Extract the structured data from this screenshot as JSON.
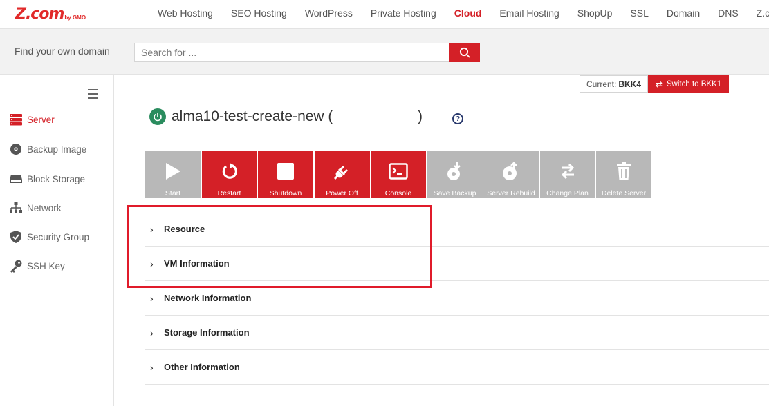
{
  "brand": {
    "logo_text": "Z.com",
    "logo_sub": "by GMO"
  },
  "nav": {
    "links": [
      {
        "label": "Web Hosting"
      },
      {
        "label": "SEO Hosting"
      },
      {
        "label": "WordPress"
      },
      {
        "label": "Private Hosting"
      },
      {
        "label": "Cloud",
        "active": true
      },
      {
        "label": "Email Hosting"
      },
      {
        "label": "ShopUp"
      },
      {
        "label": "SSL"
      },
      {
        "label": "Domain"
      },
      {
        "label": "DNS"
      },
      {
        "label": "Z.com S"
      }
    ]
  },
  "search": {
    "label": "Find your own domain",
    "placeholder": "Search for ..."
  },
  "sidebar": {
    "items": [
      {
        "label": "Server",
        "icon": "server-icon",
        "active": true
      },
      {
        "label": "Backup Image",
        "icon": "backup-image-icon"
      },
      {
        "label": "Block Storage",
        "icon": "block-storage-icon"
      },
      {
        "label": "Network",
        "icon": "network-icon"
      },
      {
        "label": "Security Group",
        "icon": "shield-icon"
      },
      {
        "label": "SSH Key",
        "icon": "key-icon"
      }
    ]
  },
  "region": {
    "current_label": "Current:",
    "current_value": "BKK4",
    "switch_label": "Switch to BKK1"
  },
  "server": {
    "name": "alma10-test-create-new (                     )",
    "help": "?"
  },
  "actions": [
    {
      "label": "Start",
      "enabled": false,
      "icon": "play-icon"
    },
    {
      "label": "Restart",
      "enabled": true,
      "icon": "restart-icon"
    },
    {
      "label": "Shutdown",
      "enabled": true,
      "icon": "stop-icon"
    },
    {
      "label": "Power Off",
      "enabled": true,
      "icon": "plug-icon"
    },
    {
      "label": "Console",
      "enabled": true,
      "icon": "console-icon"
    },
    {
      "label": "Save Backup",
      "enabled": false,
      "icon": "save-backup-icon"
    },
    {
      "label": "Server Rebuild",
      "enabled": false,
      "icon": "rebuild-icon"
    },
    {
      "label": "Change Plan",
      "enabled": false,
      "icon": "change-plan-icon"
    },
    {
      "label": "Delete Server",
      "enabled": false,
      "icon": "trash-icon"
    }
  ],
  "sections": [
    {
      "label": "Resource"
    },
    {
      "label": "VM Information"
    },
    {
      "label": "Network Information"
    },
    {
      "label": "Storage Information"
    },
    {
      "label": "Other Information"
    }
  ],
  "colors": {
    "accent": "#d42027",
    "disabled": "#b8b8b8",
    "status_on": "#2a8c5e",
    "highlight_box": "#e01b2a"
  }
}
